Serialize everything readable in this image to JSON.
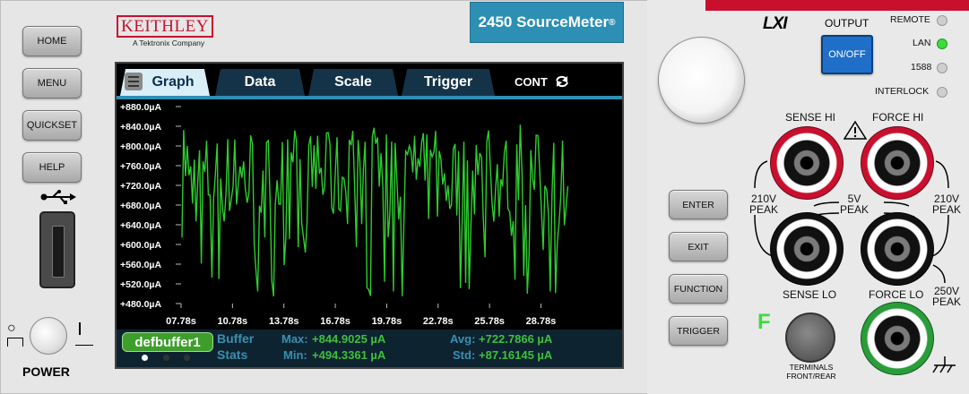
{
  "brand": {
    "name": "KEITHLEY",
    "tagline": "A Tektronix Company"
  },
  "model": {
    "name": "2450 SourceMeter",
    "reg": "®"
  },
  "left_buttons": [
    "HOME",
    "MENU",
    "QUICKSET",
    "HELP"
  ],
  "power_label": "POWER",
  "tabs": [
    {
      "label": "Graph",
      "active": true
    },
    {
      "label": "Data",
      "active": false
    },
    {
      "label": "Scale",
      "active": false
    },
    {
      "label": "Trigger",
      "active": false
    }
  ],
  "trigger_mode": "CONT",
  "chart_data": {
    "type": "line",
    "y_ticks": [
      "+880.0µA",
      "+840.0µA",
      "+800.0µA",
      "+760.0µA",
      "+720.0µA",
      "+680.0µA",
      "+640.0µA",
      "+600.0µA",
      "+560.0µA",
      "+520.0µA",
      "+480.0µA"
    ],
    "x_ticks": [
      "07.78s",
      "10.78s",
      "13.78s",
      "16.78s",
      "19.78s",
      "22.78s",
      "25.78s",
      "28.78s"
    ],
    "ylim": [
      480,
      880
    ],
    "xlim": [
      7.78,
      30.9
    ],
    "color": "#2ecc2e",
    "samples": 220,
    "series": [
      {
        "y_min": 494.3361,
        "y_max": 844.9025,
        "y_avg": 722.7866,
        "y_std": 87.16145
      }
    ]
  },
  "buffer": {
    "name": "defbuffer1",
    "title_line1": "Buffer",
    "title_line2": "Stats"
  },
  "stats": {
    "max_label": "Max:",
    "max_value": "+844.9025 µA",
    "min_label": "Min:",
    "min_value": "+494.3361 µA",
    "avg_label": "Avg:",
    "avg_value": "+722.7866 µA",
    "std_label": "Std:",
    "std_value": "+87.16145 µA"
  },
  "mid_buttons": [
    "ENTER",
    "EXIT",
    "FUNCTION",
    "TRIGGER"
  ],
  "lxi_logo": "LXI",
  "output": {
    "title": "OUTPUT",
    "button": "ON/OFF"
  },
  "indicators": [
    {
      "label": "REMOTE",
      "on": false
    },
    {
      "label": "LAN",
      "on": true
    },
    {
      "label": "1588",
      "on": false
    },
    {
      "label": "INTERLOCK",
      "on": false
    }
  ],
  "terminals": {
    "sense_hi": "SENSE HI",
    "force_hi": "FORCE HI",
    "sense_lo": "SENSE LO",
    "force_lo": "FORCE LO",
    "left_peak": "210V\nPEAK",
    "mid_peak": "5V\nPEAK",
    "right_peak": "210V\nPEAK",
    "bottom_peak": "250V\nPEAK",
    "front_indicator": "F",
    "front_rear_label": "TERMINALS\nFRONT/REAR"
  },
  "colors": {
    "keithley_red": "#c8102e",
    "model_blue": "#2e8fb4",
    "trace_green": "#2ecc2e",
    "on_off_blue": "#1f6fc9"
  }
}
